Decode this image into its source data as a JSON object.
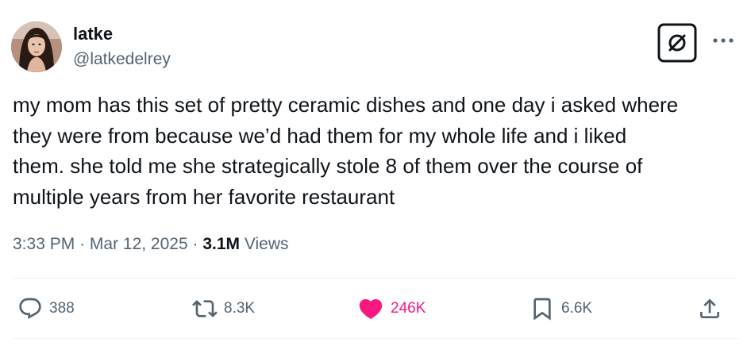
{
  "post": {
    "author": {
      "display_name": "latke",
      "handle": "@latkedelrey",
      "avatar_icon": "profile-photo"
    },
    "header_icons": [
      "grok-icon",
      "more-icon"
    ],
    "text": "my mom has this set of pretty ceramic dishes and one day i asked where\nthey were from because we’d had them for my whole life and i liked\nthem. she told me she strategically stole 8 of them over the course of\nmultiple years from her favorite restaurant",
    "time": "3:33 PM",
    "separator": "·",
    "date": "Mar 12, 2025",
    "views_count": "3.1M",
    "views_label": "Views"
  },
  "actions": {
    "replies": {
      "icon": "reply-icon",
      "count": "388"
    },
    "reposts": {
      "icon": "repost-icon",
      "count": "8.3K"
    },
    "likes": {
      "icon": "heart-icon",
      "count": "246K",
      "liked": true
    },
    "bookmarks": {
      "icon": "bookmark-icon",
      "count": "6.6K"
    },
    "share": {
      "icon": "share-icon"
    }
  },
  "colors": {
    "text": "#0f1419",
    "secondary": "#536471",
    "like": "#f91880",
    "divider": "#eff3f4"
  }
}
